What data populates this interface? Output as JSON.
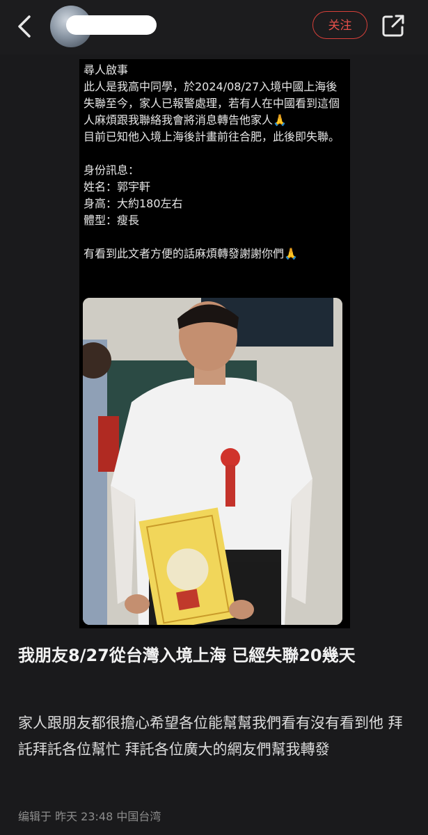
{
  "header": {
    "follow_label": "关注",
    "icons": [
      "back-icon",
      "share-icon"
    ]
  },
  "post_image": {
    "text": "尋人啟事\n此人是我高中同學，於2024/08/27入境中國上海後失聯至今，家人已報警處理，若有人在中國看到這個人麻煩跟我聯絡我會將消息轉告他家人🙏\n目前已知他入境上海後計畫前往合肥，此後即失聯。\n\n身份訊息：\n姓名：郭宇軒\n身高：大約180左右\n體型：瘦長\n\n有看到此文者方便的話麻煩轉發謝謝你們🙏",
    "fab_label": "+",
    "nav_icons": [
      "search-icon",
      "compose-icon",
      "communities-icon",
      "notifications-icon",
      "messages-icon"
    ]
  },
  "post": {
    "title": "我朋友8/27從台灣入境上海 已經失聯20幾天",
    "content": "家人跟朋友都很擔心希望各位能幫幫我們看有沒有看到他 拜託拜託各位幫忙 拜託各位廣大的網友們幫我轉發",
    "meta": "编辑于 昨天 23:48 中国台湾"
  },
  "colors": {
    "accent": "#d8403a",
    "fab": "#1d9bf0",
    "background": "#1a1a1c"
  }
}
